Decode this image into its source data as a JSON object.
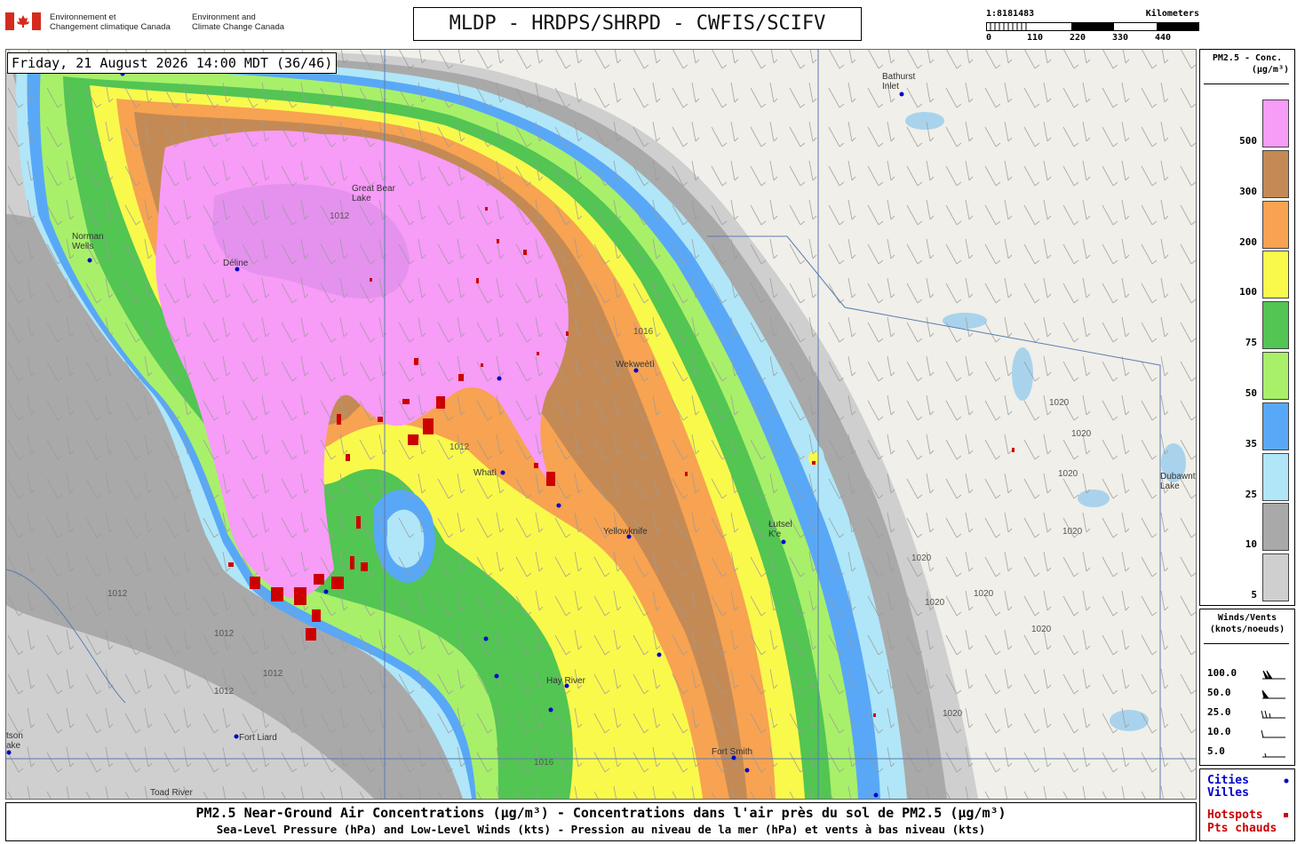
{
  "header": {
    "gov_fr_line1": "Environnement et",
    "gov_fr_line2": "Changement climatique Canada",
    "gov_en_line1": "Environment and",
    "gov_en_line2": "Climate Change Canada",
    "title": "MLDP - HRDPS/SHRPD - CWFIS/SCIFV"
  },
  "scale": {
    "ratio": "1:8181483",
    "unit": "Kilometers",
    "ticks": [
      "0",
      "110",
      "220",
      "330",
      "440"
    ]
  },
  "timestamp": "Friday, 21 August 2026 14:00 MDT (36/46)",
  "legend_pm": {
    "title_line1": "PM2.5 - Conc.",
    "title_line2": "(μg/m³)",
    "bins": [
      {
        "label": "500",
        "color": "#f79cf7"
      },
      {
        "label": "300",
        "color": "#c48a55"
      },
      {
        "label": "200",
        "color": "#f7a351"
      },
      {
        "label": "100",
        "color": "#f9f94c"
      },
      {
        "label": "75",
        "color": "#52c553"
      },
      {
        "label": "50",
        "color": "#a8f06a"
      },
      {
        "label": "35",
        "color": "#59a8f7"
      },
      {
        "label": "25",
        "color": "#b0e6f8"
      },
      {
        "label": "10",
        "color": "#a9a9a9"
      },
      {
        "label": "5",
        "color": "#cfcfcf"
      }
    ]
  },
  "legend_wind": {
    "title_line1": "Winds/Vents",
    "title_line2": "(knots/noeuds)",
    "items": [
      {
        "label": "100.0",
        "icon": "wind-barb-100"
      },
      {
        "label": "50.0",
        "icon": "wind-barb-50"
      },
      {
        "label": "25.0",
        "icon": "wind-barb-25"
      },
      {
        "label": "10.0",
        "icon": "wind-barb-10"
      },
      {
        "label": "5.0",
        "icon": "wind-barb-5"
      }
    ]
  },
  "legend_cities": {
    "cities_line1": "Cities",
    "cities_line2": "Villes",
    "hotspots_line1": "Hotspots",
    "hotspots_line2": "Pts chauds",
    "city_color": "#0000cc",
    "hotspot_color": "#cc0000"
  },
  "footer": {
    "line1": "PM2.5 Near-Ground Air Concentrations (μg/m³) - Concentrations dans l'air près du sol de PM2.5 (μg/m³)",
    "line2": "Sea-Level Pressure (hPa) and Low-Level Winds (kts) - Pression au niveau de la mer (hPa) et vents à bas niveau (kts)"
  },
  "map": {
    "places": {
      "bathurst": "Bathurst\nInlet",
      "norman_wells": "Norman\nWells",
      "deline": "Déline",
      "wekweeti": "Wekweètì",
      "whati": "Whatì",
      "lutselke": "Łutsel\nK'e",
      "yellowknife": "Yellowknife",
      "hay_river": "Hay River",
      "fort_liard": "Fort Liard",
      "fort_smith": "Fort Smith",
      "toad_river": "Toad River",
      "watson_lake": "tson\nake",
      "dubawnt": "Dubawnt\nLake",
      "great_bear": "Great Bear\nLake"
    },
    "isobars": {
      "i1012": "1012",
      "i1016": "1016",
      "i1020": "1020"
    }
  }
}
